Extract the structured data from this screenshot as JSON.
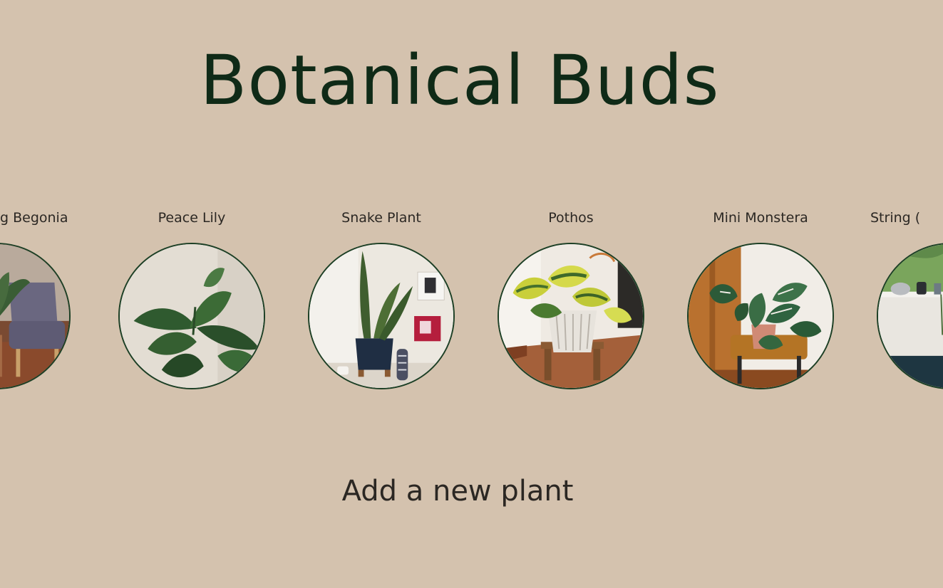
{
  "header": {
    "title": "Botanical Buds"
  },
  "carousel": {
    "items": [
      {
        "name": "Rex Begonia",
        "visible_label": "g Begonia",
        "photo": "begonia-by-armchair"
      },
      {
        "name": "Peace Lily",
        "visible_label": "Peace Lily",
        "photo": "peace-lily-closeup"
      },
      {
        "name": "Snake Plant",
        "visible_label": "Snake Plant",
        "photo": "snake-plant-navy-pot"
      },
      {
        "name": "Pothos",
        "visible_label": "Pothos",
        "photo": "pothos-white-pot"
      },
      {
        "name": "Mini Monstera",
        "visible_label": "Mini Monstera",
        "photo": "mini-monstera-on-stool"
      },
      {
        "name": "String of Pearls",
        "visible_label": "String (",
        "photo": "string-plant-windowsill"
      }
    ]
  },
  "actions": {
    "add_plant_label": "Add a new plant"
  },
  "colors": {
    "background": "#d4c2ae",
    "title": "#0f2a17",
    "text": "#2b2723",
    "photo_border": "#1c3f25"
  }
}
